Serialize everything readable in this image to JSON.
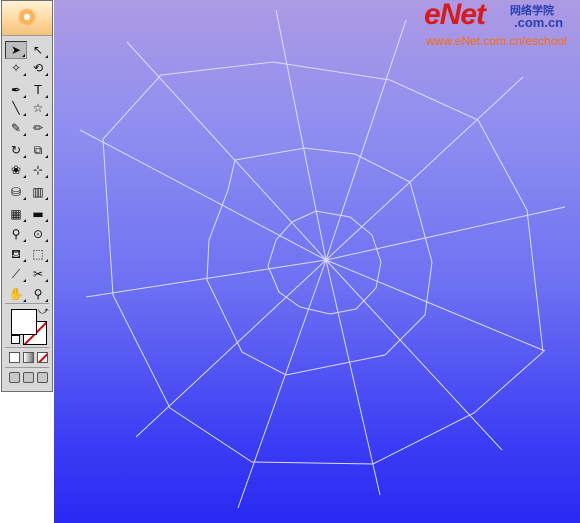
{
  "watermark": {
    "brand": "eNet",
    "brand_cn": "网络学院",
    "brand_suffix": ".com.cn",
    "url": "www.eNet.com.cn/eschool"
  },
  "toolbox": {
    "tools": [
      {
        "name": "selection-tool",
        "glyph": "➤",
        "active": true
      },
      {
        "name": "direct-selection-tool",
        "glyph": "↖"
      },
      {
        "name": "magic-wand-tool",
        "glyph": "✧"
      },
      {
        "name": "lasso-tool",
        "glyph": "⟲"
      },
      {
        "name": "pen-tool",
        "glyph": "✒"
      },
      {
        "name": "type-tool",
        "glyph": "T"
      },
      {
        "name": "line-segment-tool",
        "glyph": "╲"
      },
      {
        "name": "star-tool",
        "glyph": "☆"
      },
      {
        "name": "paintbrush-tool",
        "glyph": "✎"
      },
      {
        "name": "pencil-tool",
        "glyph": "✏"
      },
      {
        "name": "rotate-tool",
        "glyph": "↻"
      },
      {
        "name": "scale-tool",
        "glyph": "⧉"
      },
      {
        "name": "warp-tool",
        "glyph": "❀"
      },
      {
        "name": "free-transform-tool",
        "glyph": "⊹"
      },
      {
        "name": "symbol-sprayer-tool",
        "glyph": "⛁"
      },
      {
        "name": "column-graph-tool",
        "glyph": "▥"
      },
      {
        "name": "mesh-tool",
        "glyph": "▦"
      },
      {
        "name": "gradient-tool",
        "glyph": "▬"
      },
      {
        "name": "eyedropper-tool",
        "glyph": "⚲"
      },
      {
        "name": "blend-tool",
        "glyph": "⊙"
      },
      {
        "name": "live-paint-bucket-tool",
        "glyph": "⛾"
      },
      {
        "name": "live-paint-selection-tool",
        "glyph": "⬚"
      },
      {
        "name": "slice-tool",
        "glyph": "⟋"
      },
      {
        "name": "scissors-tool",
        "glyph": "✂"
      },
      {
        "name": "hand-tool",
        "glyph": "✋"
      },
      {
        "name": "zoom-tool",
        "glyph": "⚲"
      }
    ],
    "fill_color": "#ffffff",
    "stroke_color": "#ffffff",
    "none_indicator_color": "#d40000"
  },
  "canvas": {
    "gradient_top": "#ad9ae4",
    "gradient_bottom": "#2a28f3",
    "web_stroke": "#dcdcff"
  }
}
